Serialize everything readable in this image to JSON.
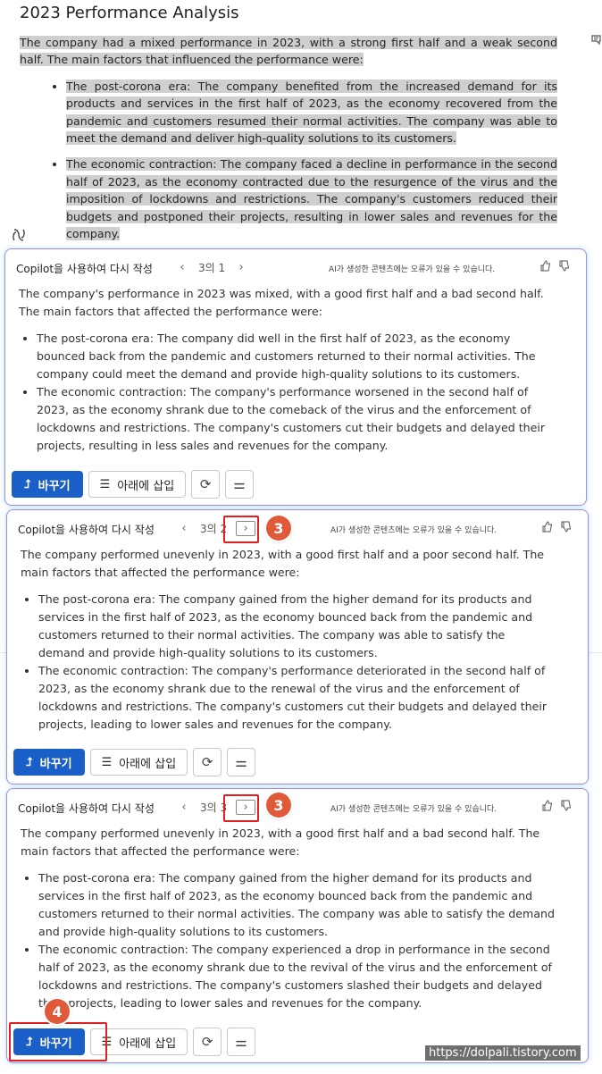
{
  "document": {
    "title": "2023 Performance Analysis",
    "intro": "The company had a mixed performance in 2023, with a strong first half and a weak second half. The main factors that influenced the performance were:",
    "bullets": [
      "The post-corona era: The company benefited from the increased demand for its products and services in the first half of 2023, as the economy recovered from the pandemic and customers resumed their normal activities. The company was able to meet the demand and deliver high-quality solutions to its customers.",
      "The economic contraction: The company faced a decline in performance in the second half of 2023, as the economy contracted due to the resurgence of the virus and the imposition of lockdowns and restrictions. The company's customers reduced their budgets and postponed their projects, resulting in lower sales and revenues for the company."
    ]
  },
  "cards": [
    {
      "header_title": "Copilot을 사용하여 다시 작성",
      "page_indicator": "3의 1",
      "disclaimer": "AI가 생성한 콘텐츠에는 오류가 있을 수 있습니다.",
      "intro": "The company's performance in 2023 was mixed, with a good first half and a bad second half. The main factors that affected the performance were:",
      "bullets": [
        "The post-corona era: The company did well in the first half of 2023, as the economy bounced back from the pandemic and customers returned to their normal activities. The company could meet the demand and provide high-quality solutions to its customers.",
        "The economic contraction: The company's performance worsened in the second half of 2023, as the economy shrank due to the comeback of the virus and the enforcement of lockdowns and restrictions. The company's customers cut their budgets and delayed their projects, resulting in less sales and revenues for the company."
      ],
      "replace_label": "바꾸기",
      "insert_label": "아래에 삽입"
    },
    {
      "header_title": "Copilot을 사용하여 다시 작성",
      "page_indicator": "3의 2",
      "disclaimer": "AI가 생성한 콘텐츠에는 오류가 있을 수 있습니다.",
      "intro": "The company performed unevenly in 2023, with a good first half and a poor second half. The main factors that affected the performance were:",
      "bullets": [
        "The post-corona era: The company gained from the higher demand for its products and services in the first half of 2023, as the economy bounced back from the pandemic and customers returned to their normal activities. The company was able to satisfy the demand and provide high-quality solutions to its customers.",
        "The economic contraction: The company's performance deteriorated in the second half of 2023, as the economy shrank due to the renewal of the virus and the enforcement of lockdowns and restrictions. The company's customers cut their budgets and delayed their projects, leading to lower sales and revenues for the company."
      ],
      "replace_label": "바꾸기",
      "insert_label": "아래에 삽입",
      "callout": "3"
    },
    {
      "header_title": "Copilot을 사용하여 다시 작성",
      "page_indicator": "3의 3",
      "disclaimer": "AI가 생성한 콘텐츠에는 오류가 있을 수 있습니다.",
      "intro": "The company performed unevenly in 2023, with a good first half and a bad second half. The main factors that affected the performance were:",
      "bullets": [
        "The post-corona era: The company gained from the higher demand for its products and services in the first half of 2023, as the economy bounced back from the pandemic and customers returned to their normal activities. The company was able to satisfy the demand and provide high-quality solutions to its customers.",
        "The economic contraction: The company experienced a drop in performance in the second half of 2023, as the economy shrank due to the revival of the virus and the enforcement of lockdowns and restrictions. The company's customers slashed their budgets and delayed their projects, leading to lower sales and revenues for the company."
      ],
      "replace_label": "바꾸기",
      "insert_label": "아래에 삽입",
      "callout": "3",
      "replace_callout": "4"
    }
  ],
  "watermark": "https://dolpali.tistory.com",
  "colors": {
    "accent": "#1a5fc8",
    "card_border": "#9b8cf0",
    "callout": "#e05a3a",
    "highlight": "#cfcfcf"
  }
}
